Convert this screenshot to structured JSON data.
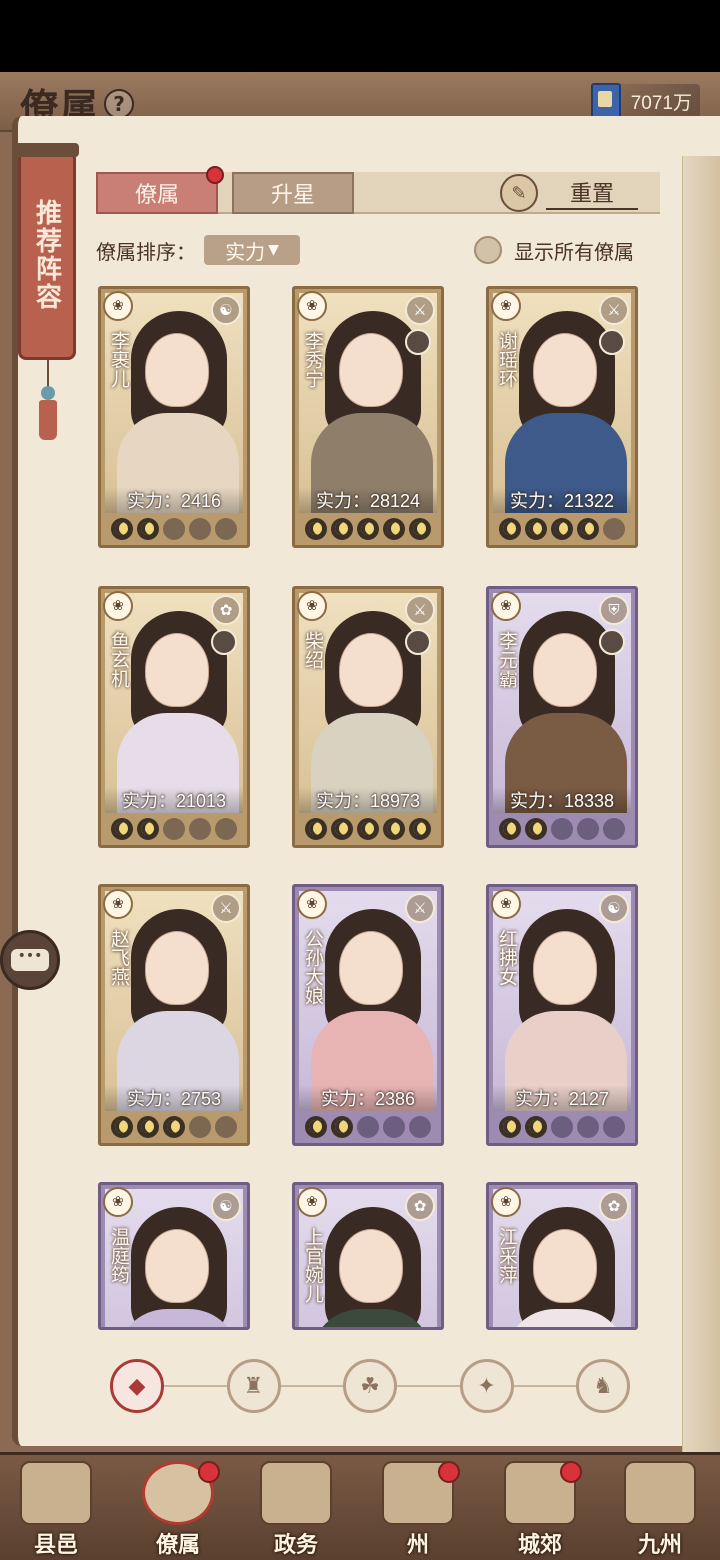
{
  "header": {
    "title": "僚属",
    "help_icon": "?",
    "currency_icon": "book-icon",
    "currency_value": "7071万"
  },
  "scroll_banner": {
    "text": "推荐阵容"
  },
  "tabs": [
    {
      "label": "僚属",
      "active": true,
      "badge": true
    },
    {
      "label": "升星",
      "active": false
    }
  ],
  "reset": {
    "label": "重置",
    "icon": "reset-icon"
  },
  "sort": {
    "label": "僚属排序：",
    "value": "实力",
    "arrow": "▼"
  },
  "show_all": {
    "label": "显示所有僚属"
  },
  "cards": [
    {
      "name": "李裹儿",
      "power": "实力：2416",
      "rarity": "gold",
      "skill_icon": "☯",
      "stars_on": 2,
      "stars_total": 5
    },
    {
      "name": "李秀宁",
      "power": "实力：28124",
      "rarity": "gold",
      "skill_icon": "⚔",
      "stars_on": 5,
      "stars_total": 5
    },
    {
      "name": "谢瑶环",
      "power": "实力：21322",
      "rarity": "gold",
      "skill_icon": "⚔",
      "stars_on": 4,
      "stars_total": 5
    },
    {
      "name": "鱼玄机",
      "power": "实力：21013",
      "rarity": "gold",
      "skill_icon": "✿",
      "stars_on": 2,
      "stars_total": 5
    },
    {
      "name": "柴绍",
      "power": "实力：18973",
      "rarity": "gold",
      "skill_icon": "⚔",
      "stars_on": 5,
      "stars_total": 5
    },
    {
      "name": "李元霸",
      "power": "实力：18338",
      "rarity": "purple",
      "skill_icon": "⛨",
      "stars_on": 2,
      "stars_total": 5
    },
    {
      "name": "赵飞燕",
      "power": "实力：2753",
      "rarity": "gold",
      "skill_icon": "⚔",
      "stars_on": 3,
      "stars_total": 5
    },
    {
      "name": "公孙大娘",
      "power": "实力：2386",
      "rarity": "purple",
      "skill_icon": "⚔",
      "stars_on": 2,
      "stars_total": 5
    },
    {
      "name": "红拂女",
      "power": "实力：2127",
      "rarity": "purple",
      "skill_icon": "☯",
      "stars_on": 2,
      "stars_total": 5
    },
    {
      "name": "温庭筠",
      "power": "",
      "rarity": "purple",
      "skill_icon": "☯",
      "stars_on": 0,
      "stars_total": 0
    },
    {
      "name": "上官婉儿",
      "power": "",
      "rarity": "purple",
      "skill_icon": "✿",
      "stars_on": 0,
      "stars_total": 0
    },
    {
      "name": "江采萍",
      "power": "",
      "rarity": "purple",
      "skill_icon": "✿",
      "stars_on": 0,
      "stars_total": 0
    }
  ],
  "filters": [
    {
      "icon": "all-diamond-icon",
      "glyph": "◆",
      "active": true
    },
    {
      "icon": "official-hat-icon",
      "glyph": "♜",
      "active": false
    },
    {
      "icon": "cat-icon",
      "glyph": "☘",
      "active": false
    },
    {
      "icon": "fan-icon",
      "glyph": "✦",
      "active": false
    },
    {
      "icon": "beast-icon",
      "glyph": "♞",
      "active": false
    }
  ],
  "bottom_nav": [
    {
      "label": "县邑",
      "badge": false,
      "active": false
    },
    {
      "label": "僚属",
      "badge": true,
      "active": true
    },
    {
      "label": "政务",
      "badge": false,
      "active": false
    },
    {
      "label": "州",
      "badge": true,
      "active": false
    },
    {
      "label": "城郊",
      "badge": true,
      "active": false
    },
    {
      "label": "九州",
      "badge": false,
      "active": false
    }
  ],
  "colors": {
    "active_tab": "#c97f76",
    "badge_red": "#d8323a",
    "gold_card": "#b99a6c",
    "purple_card": "#9d8bb2"
  }
}
